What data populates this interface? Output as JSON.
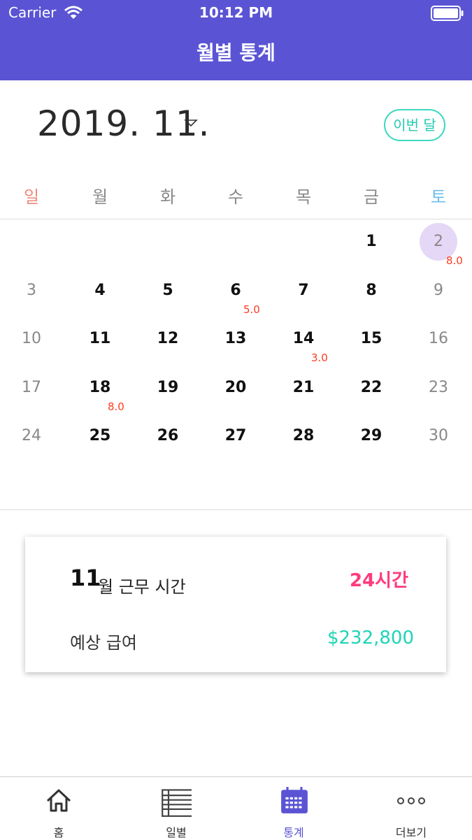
{
  "status_bar": {
    "carrier": "Carrier",
    "time": "10:12 PM"
  },
  "header": {
    "title": "월별 통계"
  },
  "month": {
    "label": "2019. 11.",
    "this_month_button": "이번 달"
  },
  "weekdays": [
    "일",
    "월",
    "화",
    "수",
    "목",
    "금",
    "토"
  ],
  "calendar": {
    "days": [
      "1",
      "2",
      "3",
      "4",
      "5",
      "6",
      "7",
      "8",
      "9",
      "10",
      "11",
      "12",
      "13",
      "14",
      "15",
      "16",
      "17",
      "18",
      "19",
      "20",
      "21",
      "22",
      "23",
      "24",
      "25",
      "26",
      "27",
      "28",
      "29",
      "30"
    ],
    "today": "2",
    "hours": {
      "2": "8.0",
      "6": "5.0",
      "14": "3.0",
      "18": "8.0"
    }
  },
  "summary": {
    "month_number": "11",
    "work_label": "월 근무 시간",
    "work_hours": "24시간",
    "salary_label": "예상 급여",
    "salary_value": "$232,800"
  },
  "tabs": [
    {
      "label": "홈",
      "icon": "home-icon"
    },
    {
      "label": "일별",
      "icon": "list-icon"
    },
    {
      "label": "통계",
      "icon": "calendar-icon",
      "active": true
    },
    {
      "label": "더보기",
      "icon": "more-icon"
    }
  ],
  "colors": {
    "header": "#5a54d4",
    "accent_teal": "#3ed8c1",
    "hours_red": "#ff3b1f",
    "work_hours_pink": "#ff3b7c",
    "salary_teal": "#1ed4b6",
    "today_circle": "#e4d8f6"
  }
}
